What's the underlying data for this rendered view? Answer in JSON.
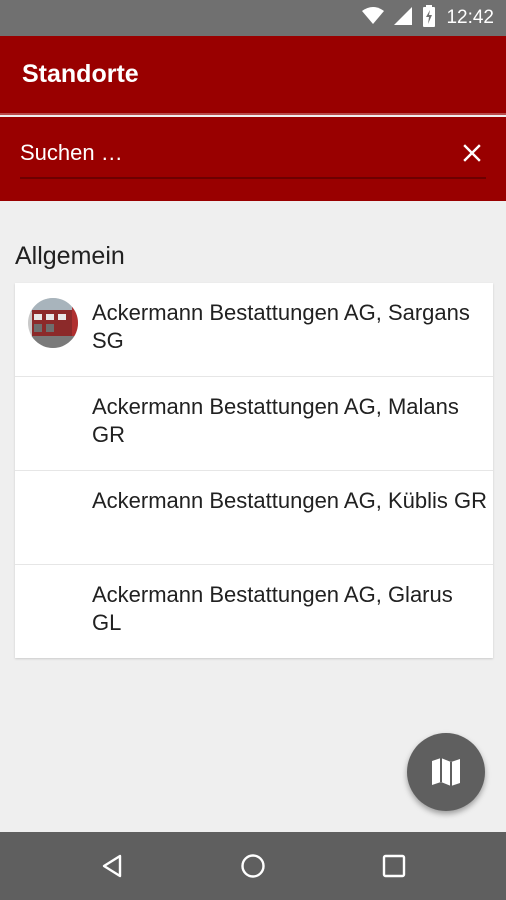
{
  "status_bar": {
    "time": "12:42",
    "icons": [
      "wifi-icon",
      "signal-icon",
      "battery-charging-icon"
    ]
  },
  "app_bar": {
    "title": "Standorte"
  },
  "search": {
    "placeholder": "Suchen …",
    "value": "",
    "clear_icon": "close-icon"
  },
  "section": {
    "title": "Allgemein"
  },
  "locations": [
    {
      "name": "Ackermann Bestattungen AG, Sargans SG",
      "has_image": true
    },
    {
      "name": "Ackermann Bestattungen AG, Malans GR",
      "has_image": false
    },
    {
      "name": "Ackermann Bestattungen AG, Küblis GR",
      "has_image": false
    },
    {
      "name": "Ackermann Bestattungen AG, Glarus GL",
      "has_image": false
    }
  ],
  "fab": {
    "icon": "map-icon"
  },
  "nav_bar": {
    "icons": [
      "back-icon",
      "home-icon",
      "recents-icon"
    ]
  },
  "colors": {
    "primary": "#990000",
    "status_bar": "#707070",
    "background": "#efefef",
    "fab": "#5f5f5f",
    "nav_bar": "#5f5f5f"
  }
}
